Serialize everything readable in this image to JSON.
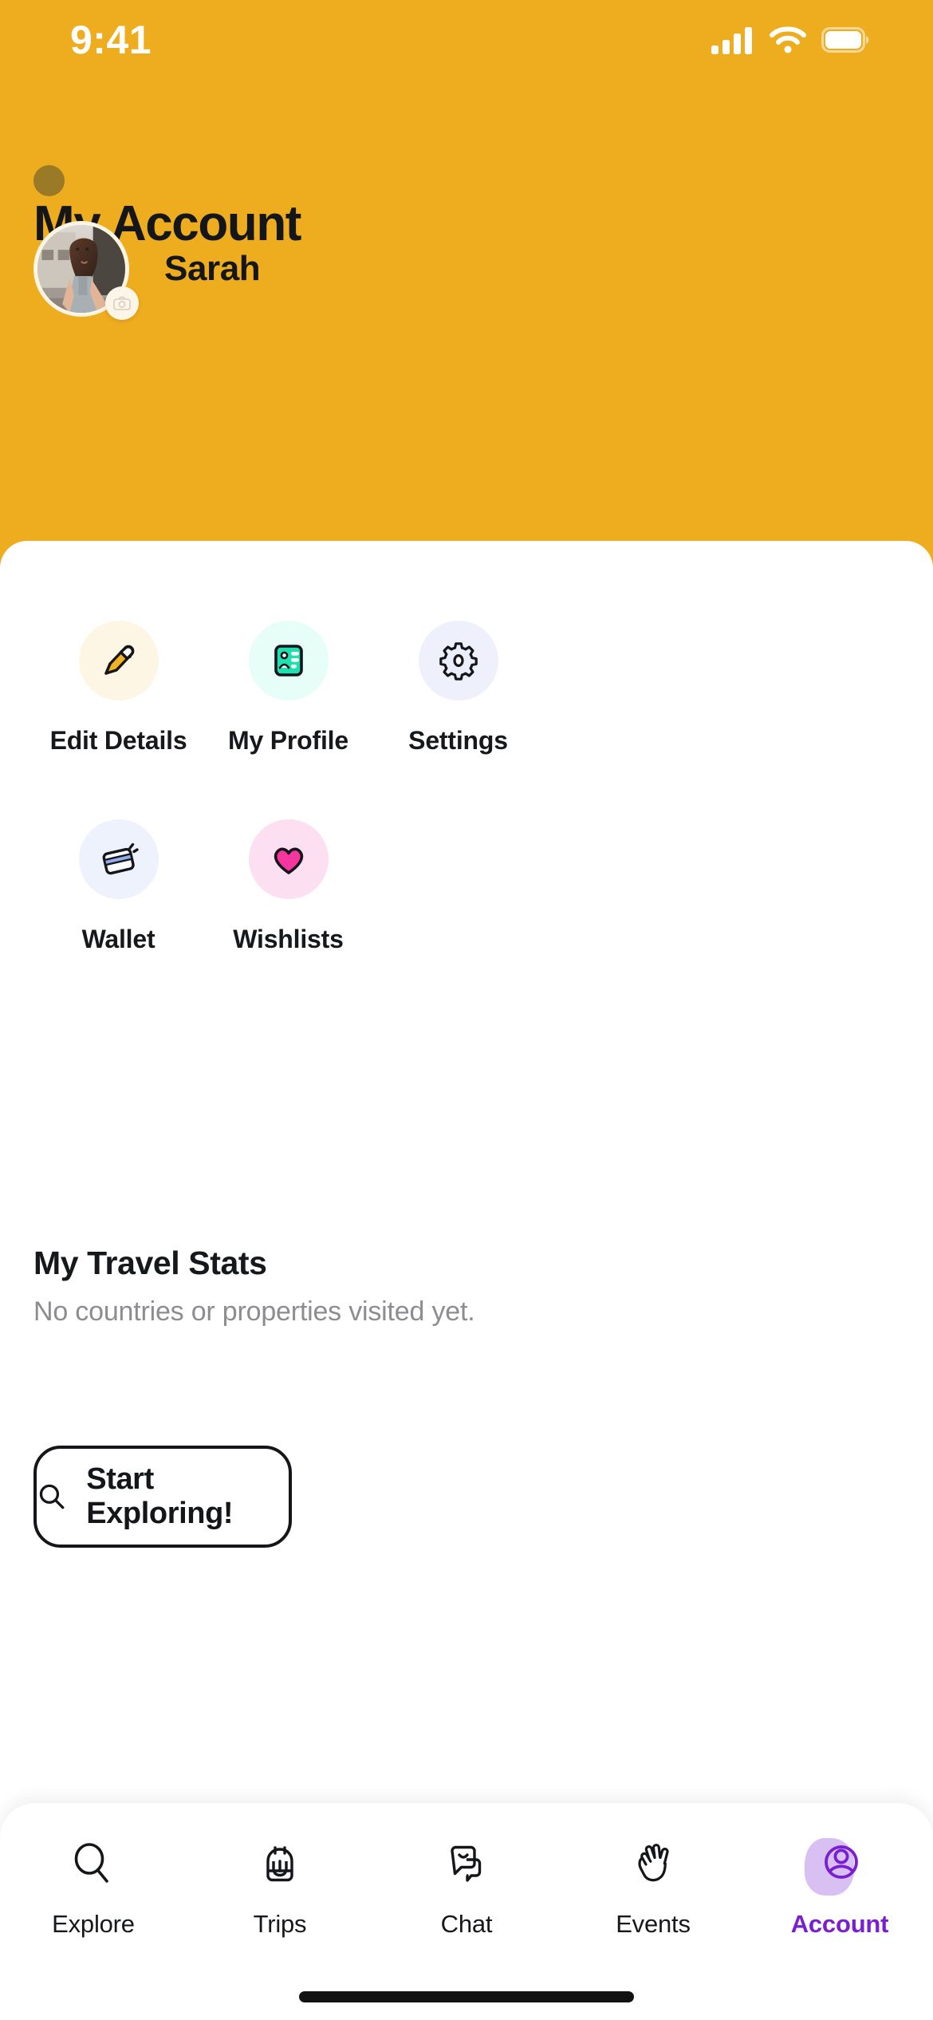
{
  "theme": {
    "header_bg": "#eeac1f",
    "sheet_bg": "#ffffff",
    "text_primary": "#16181c",
    "text_muted": "#8c8c91",
    "accent": "#7a1fd0",
    "accent_blob": "#c9a8ee"
  },
  "status_bar": {
    "time": "9:41",
    "cellular_icon": "signal-bars-icon",
    "wifi_icon": "wifi-icon",
    "battery_icon": "battery-icon"
  },
  "header": {
    "dot_icon": "header-dot-icon",
    "title": "My Account",
    "user_name": "Sarah",
    "avatar_icon": "avatar-photo",
    "avatar_badge_icon": "camera-badge-icon"
  },
  "actions": [
    {
      "label": "Edit Details",
      "icon": "pencil-icon",
      "bg": "#fdf6e4",
      "key": "edit-details"
    },
    {
      "label": "My Profile",
      "icon": "id-card-icon",
      "bg": "#e7fdf8",
      "key": "my-profile"
    },
    {
      "label": "Settings",
      "icon": "gear-icon",
      "bg": "#eef0fb",
      "key": "settings"
    },
    {
      "label": "Wallet",
      "icon": "wallet-card-icon",
      "bg": "#eef2fc",
      "key": "wallet"
    },
    {
      "label": "Wishlists",
      "icon": "heart-icon",
      "bg": "#fcdff1",
      "key": "wishlists"
    }
  ],
  "travel_stats": {
    "title": "My Travel Stats",
    "subtitle": "No countries or properties visited yet."
  },
  "explore_button": {
    "label": "Start Exploring!",
    "icon": "search-icon"
  },
  "tabbar": {
    "active": "Account",
    "items": [
      {
        "label": "Explore",
        "icon": "search-icon",
        "key": "explore"
      },
      {
        "label": "Trips",
        "icon": "backpack-icon",
        "key": "trips"
      },
      {
        "label": "Chat",
        "icon": "chat-bubbles-icon",
        "key": "chat"
      },
      {
        "label": "Events",
        "icon": "waving-hand-icon",
        "key": "events"
      },
      {
        "label": "Account",
        "icon": "person-circle-icon",
        "key": "account"
      }
    ]
  }
}
